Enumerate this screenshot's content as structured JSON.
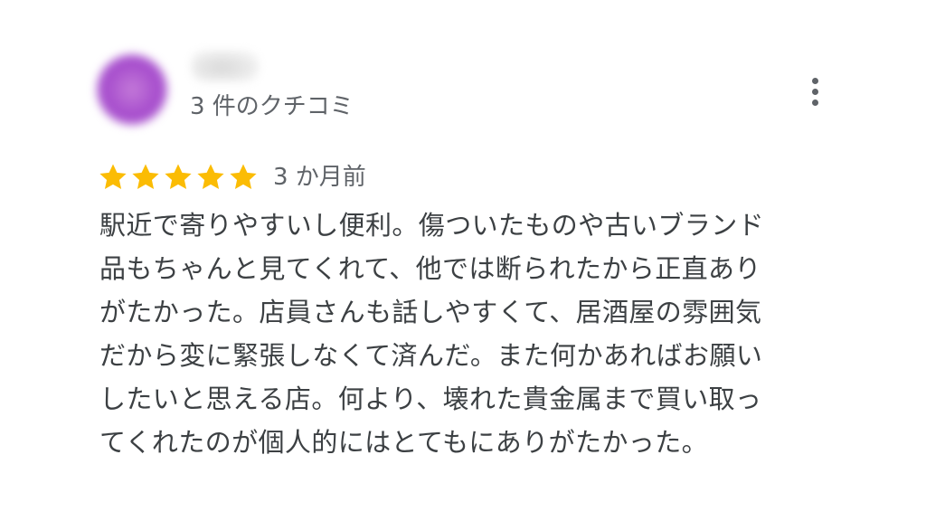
{
  "reviewer": {
    "avatar_color": "#a54bcc",
    "review_count_label": "3 件のクチコミ"
  },
  "menu": {
    "icon": "more-vert-icon"
  },
  "review": {
    "rating": 5,
    "rating_max": 5,
    "star_color": "#fbbc04",
    "date": "3 か月前",
    "text": "駅近で寄りやすいし便利。傷ついたものや古いブランド\n品もちゃんと見てくれて、他では断られたから正直あり\nがたかった。店員さんも話しやすくて、居酒屋の雰囲気\nだから変に緊張しなくて済んだ。また何かあればお願い\nしたいと思える店。何より、壊れた貴金属まで買い取っ\nてくれたのが個人的にはとてもにありがたかった。"
  }
}
